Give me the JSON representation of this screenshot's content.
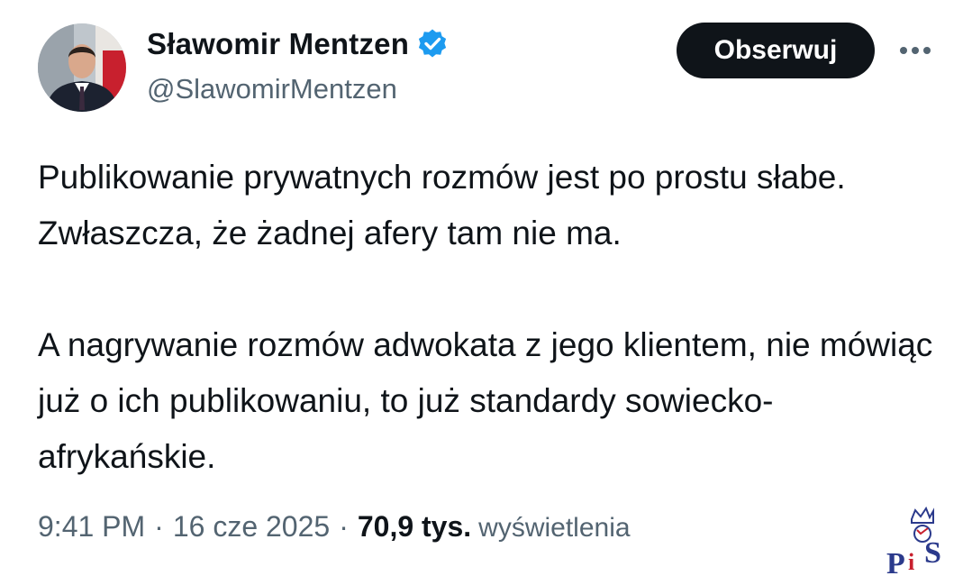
{
  "author": {
    "name": "Sławomir Mentzen",
    "handle": "@SlawomirMentzen",
    "verified_icon": "verified-badge-icon",
    "verified_color": "#1d9bf0"
  },
  "actions": {
    "follow_label": "Obserwuj",
    "more_icon": "more-horizontal-icon"
  },
  "tweet": {
    "paragraphs": [
      "Publikowanie prywatnych rozmów jest po prostu słabe. Zwłaszcza, że żadnej afery tam nie ma.",
      "A nagrywanie rozmów adwokata z jego klientem, nie mówiąc już o ich publikowaniu, to już standardy sowiecko-afrykańskie."
    ]
  },
  "meta": {
    "time": "9:41 PM",
    "separator": "·",
    "date": "16 cze 2025",
    "views_count": "70,9 tys.",
    "views_label": "wyświetlenia"
  },
  "watermark": {
    "text": "PiS"
  },
  "colors": {
    "text_primary": "#0f1419",
    "text_secondary": "#536471",
    "button_bg": "#0f1419"
  }
}
